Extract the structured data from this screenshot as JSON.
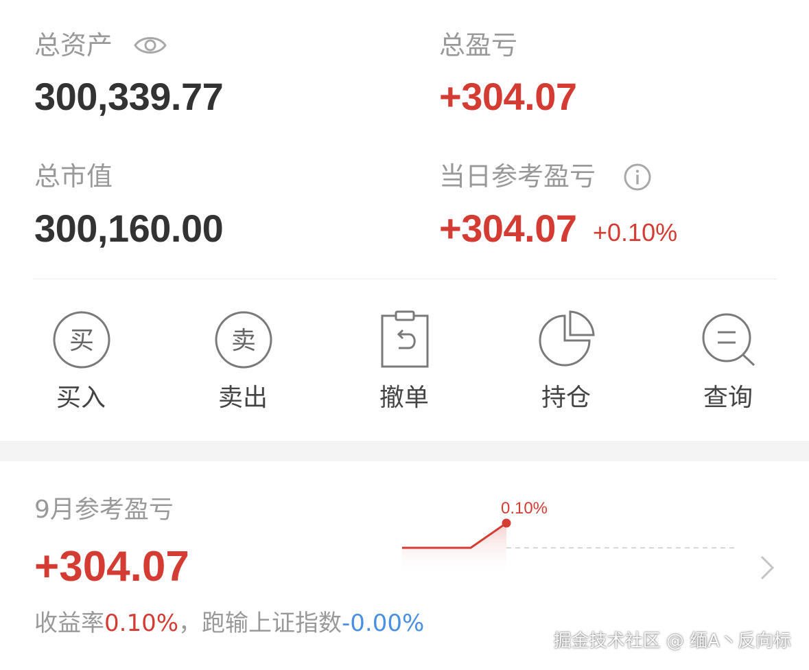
{
  "summary": {
    "total_assets_label": "总资产",
    "total_assets_value": "300,339.77",
    "total_pnl_label": "总盈亏",
    "total_pnl_value": "+304.07",
    "market_value_label": "总市值",
    "market_value_value": "300,160.00",
    "daily_pnl_label": "当日参考盈亏",
    "daily_pnl_value": "+304.07",
    "daily_pnl_pct": "+0.10%"
  },
  "icons": {
    "visibility": "eye-icon",
    "info": "info-icon"
  },
  "actions": [
    {
      "label": "买入",
      "icon": "buy-icon",
      "glyph": "买"
    },
    {
      "label": "卖出",
      "icon": "sell-icon",
      "glyph": "卖"
    },
    {
      "label": "撤单",
      "icon": "cancel-order-icon"
    },
    {
      "label": "持仓",
      "icon": "position-pie-icon"
    },
    {
      "label": "查询",
      "icon": "query-search-icon"
    }
  ],
  "monthly": {
    "label": "9月参考盈亏",
    "value": "+304.07",
    "return_prefix": "收益率",
    "return_value": "0.10%",
    "compare_text": "，跑输上证指数",
    "compare_value": "-0.00%"
  },
  "chart_data": {
    "type": "line",
    "series": [
      {
        "values": [
          0,
          0,
          0.1
        ]
      }
    ],
    "data_labels": [
      "0.10%"
    ],
    "baseline": 0,
    "ylim": [
      0,
      0.1
    ]
  },
  "watermark": "掘金技术社区 @ 缅A丶反向标",
  "colors": {
    "gain": "#d43c33",
    "loss": "#4a90e2",
    "label": "#999999",
    "text": "#333333"
  }
}
